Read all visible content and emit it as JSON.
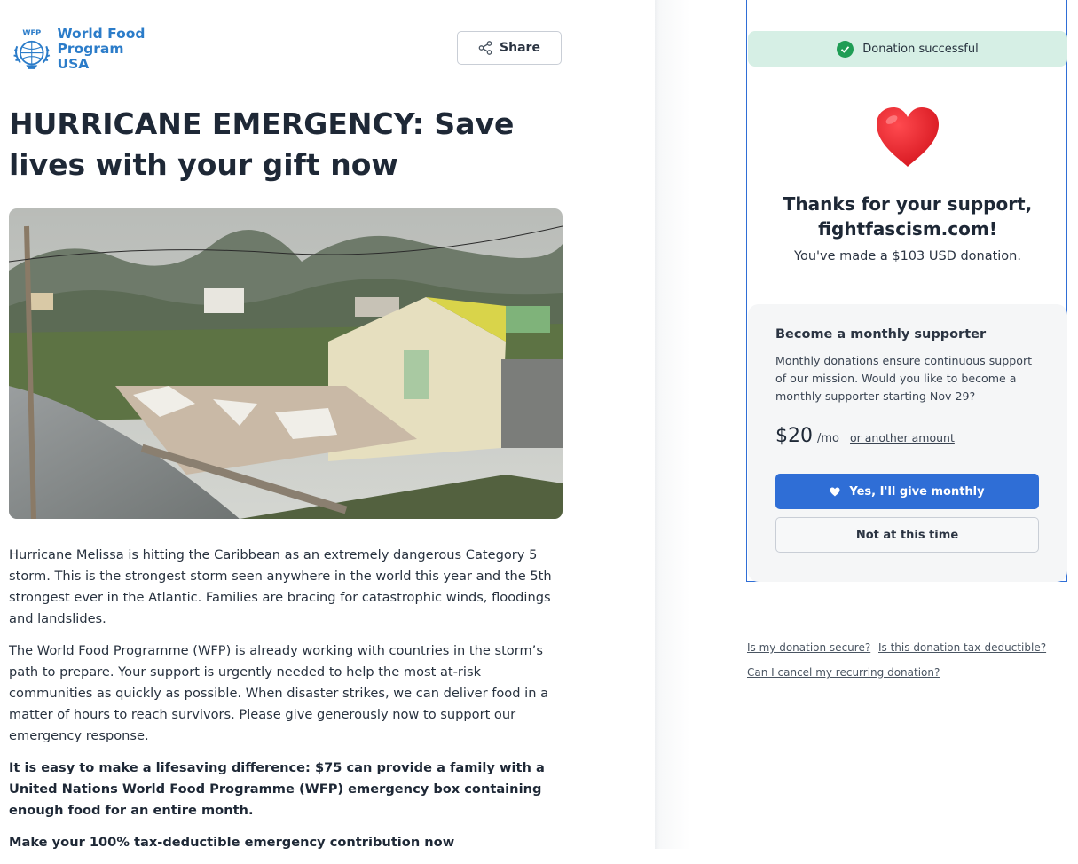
{
  "header": {
    "logo_badge": "WFP",
    "logo_line1": "World Food",
    "logo_line2": "Program USA",
    "share_label": "Share"
  },
  "campaign": {
    "title": "HURRICANE EMERGENCY: Save lives with your gift now",
    "paragraphs": [
      "Hurricane Melissa is hitting the Caribbean as an extremely dangerous Category 5 storm. This is the strongest storm seen anywhere in the world this year and the 5th strongest ever in the Atlantic. Families are bracing for catastrophic winds, floodings and landslides.",
      "The World Food Programme (WFP) is already working with countries in the storm’s path to prepare. Your support is urgently needed to help the most at-risk communities as quickly as possible. When disaster strikes, we can deliver food in a matter of hours to reach survivors. Please give generously now to support our emergency response.",
      "It is easy to make a lifesaving difference: $75 can provide a family with a United Nations World Food Programme (WFP) emergency box containing enough food for an entire month.",
      "Make your 100% tax-deductible emergency contribution now"
    ]
  },
  "donation": {
    "success_text": "Donation successful",
    "thanks_text": "Thanks for your support, fightfascism.com!",
    "made_text": "You've made a $103 USD donation.",
    "monthly": {
      "title": "Become a monthly supporter",
      "description": "Monthly donations ensure continuous support of our mission. Would you like to become a monthly supporter starting Nov 29?",
      "amount": "$20",
      "per": "/mo",
      "other_amount": "or another amount",
      "yes_label": "Yes, I'll give monthly",
      "no_label": "Not at this time"
    },
    "faq": {
      "secure": "Is my donation secure?",
      "tax": "Is this donation tax-deductible?",
      "cancel": "Can I cancel my recurring donation?"
    }
  },
  "colors": {
    "brand_blue": "#2b7cc9",
    "primary_button": "#2f6ed6",
    "success_bg": "#d6efe5",
    "success_check": "#1f9d55",
    "heart": "#e8222b"
  }
}
